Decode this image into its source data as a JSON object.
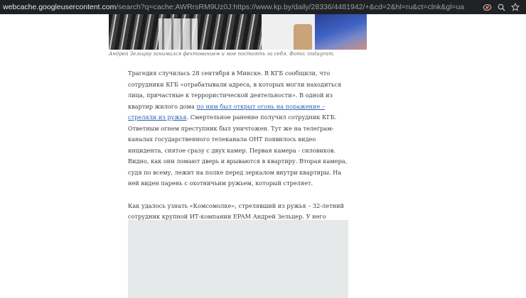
{
  "browser": {
    "url_host": "webcache.googleusercontent.com",
    "url_rest": "/search?q=cache:AWRrsRM9Uz0J:https://www.kp.by/daily/28336/4481942/+&cd=2&hl=ru&ct=clnk&gl=ua",
    "icons": {
      "tracking": "tracking-blocked-icon",
      "zoom": "zoom-icon",
      "bookmark": "bookmark-star-icon"
    }
  },
  "photo": {
    "caption": "Андрей Зельцер занимался фехтованием и мое постоять за себя. Фото: instagram."
  },
  "article": {
    "p1_text1": "Трагедия случилась 28 сентября в Минске. В КГБ сообщили, что сотрудники КГБ «отрабатывали адреса, в которых могли находиться лица, причастные к террористической деятельности». В одной из квартир жилого дома ",
    "p1_link": "по ним был открыт огонь на поражение – стреляли из ружья",
    "p1_text2": ". Смертельное ранение получил сотрудник КГБ. Ответным огнем преступник был уничтожен. Тут же на телеграм-каналах государственного телеканала ОНТ появилось видео инцидента, снятое сразу с двух камер. Первая камера - силовиков. Видно, как они ломают дверь и врываются в квартиру. Вторая камера, судя по всему, лежит на полке перед зеркалом внутри квартиры. На ней виден парень с охотничьим ружьем, который стреляет.",
    "p2": "Как удалось узнать «Комсомолке», стрелявший из ружья – 32-летний сотрудник крупной ИТ-компании EPAM Андрей Зельцер. У него осталась жена и ребенок. Как \"Комсомолке\" сказали одноклассники стрелка, трудно представить, что могло сподвигнуть его на такой поступок."
  }
}
